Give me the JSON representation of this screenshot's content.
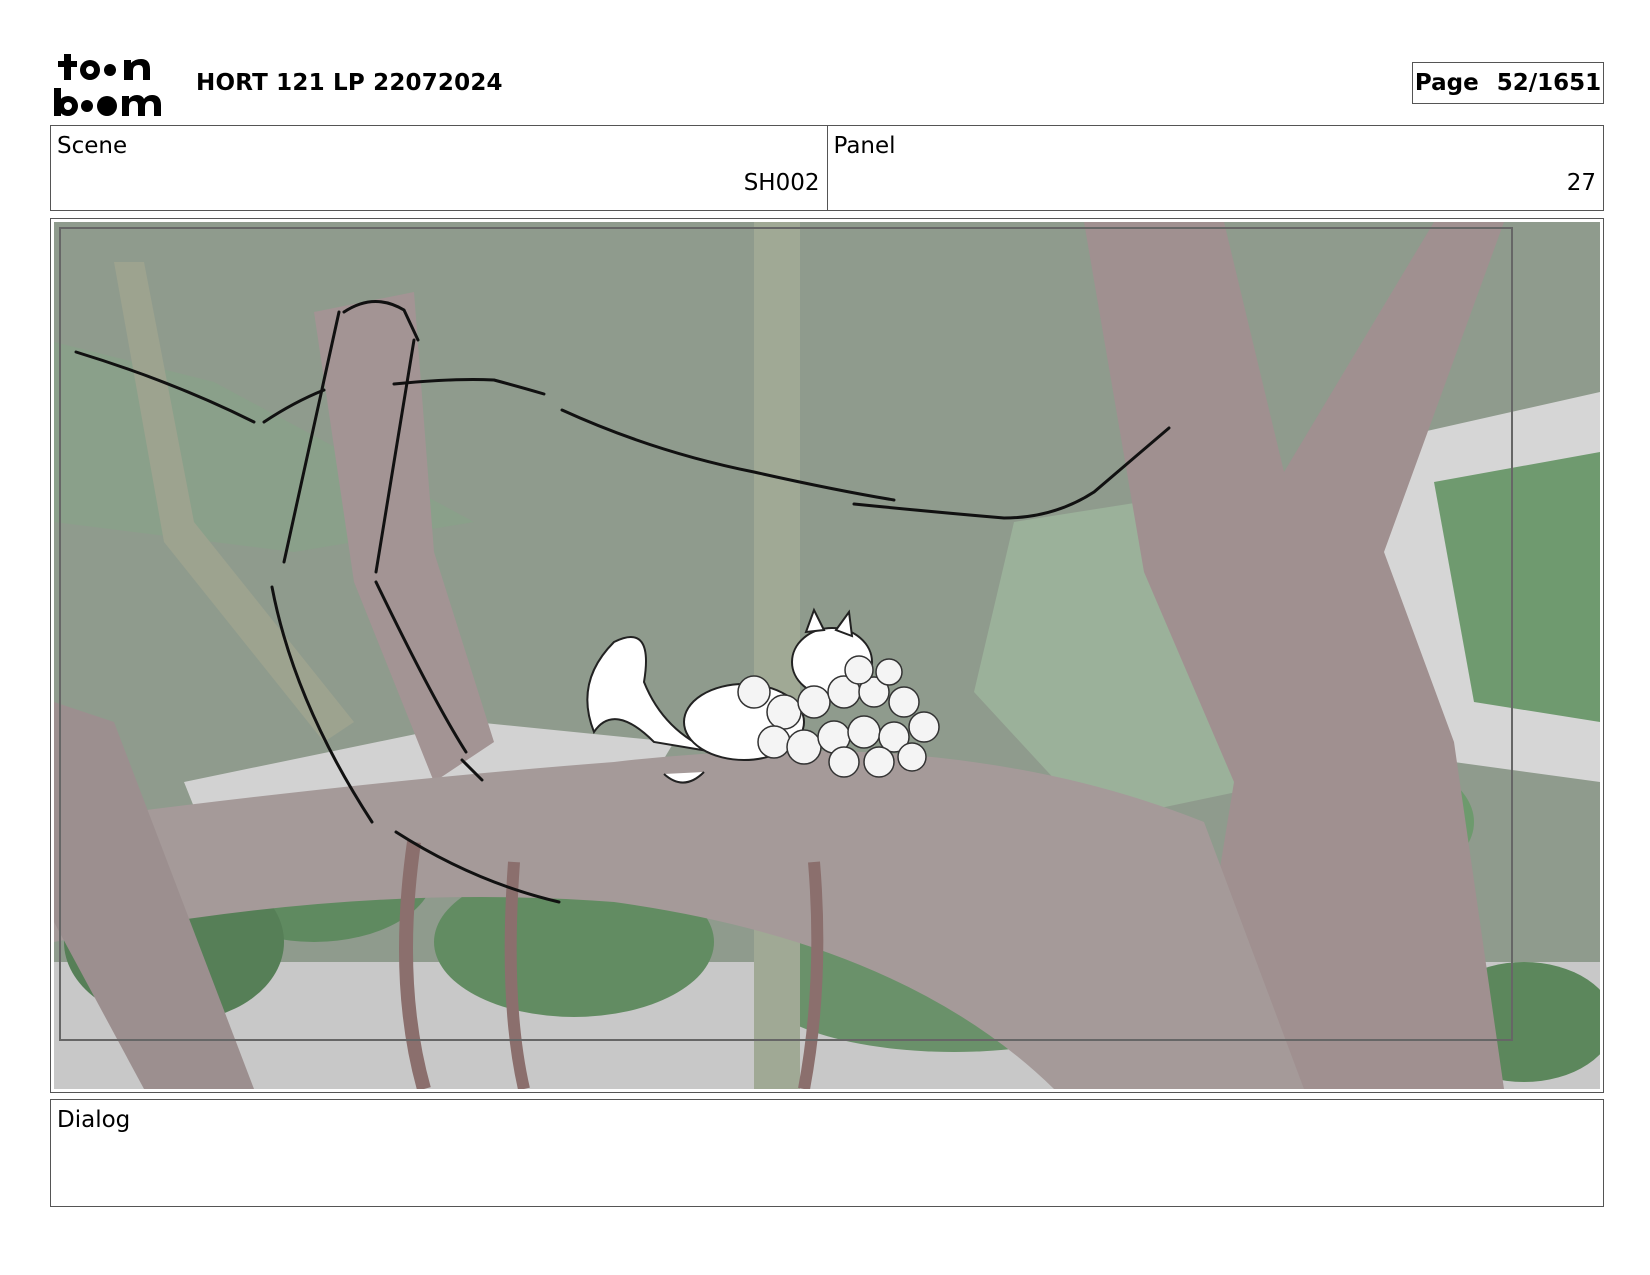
{
  "header": {
    "logo_icon": "toonboom-logo",
    "logo_text": "toonboom",
    "doc_title": "HORT 121 LP 22072024",
    "page_label": "Page",
    "page_value": "52/1651"
  },
  "scene": {
    "label": "Scene",
    "value": "SH002"
  },
  "panel": {
    "label": "Panel",
    "value": "27"
  },
  "artwork": {
    "description_icon": "storyboard-panel-image",
    "colors": {
      "sky": "#8f9b8d",
      "branch": "#a59a99",
      "foliage": "#7d9d7d",
      "white_gap": "#d6d6d6"
    }
  },
  "dialog": {
    "label": "Dialog",
    "text": ""
  }
}
